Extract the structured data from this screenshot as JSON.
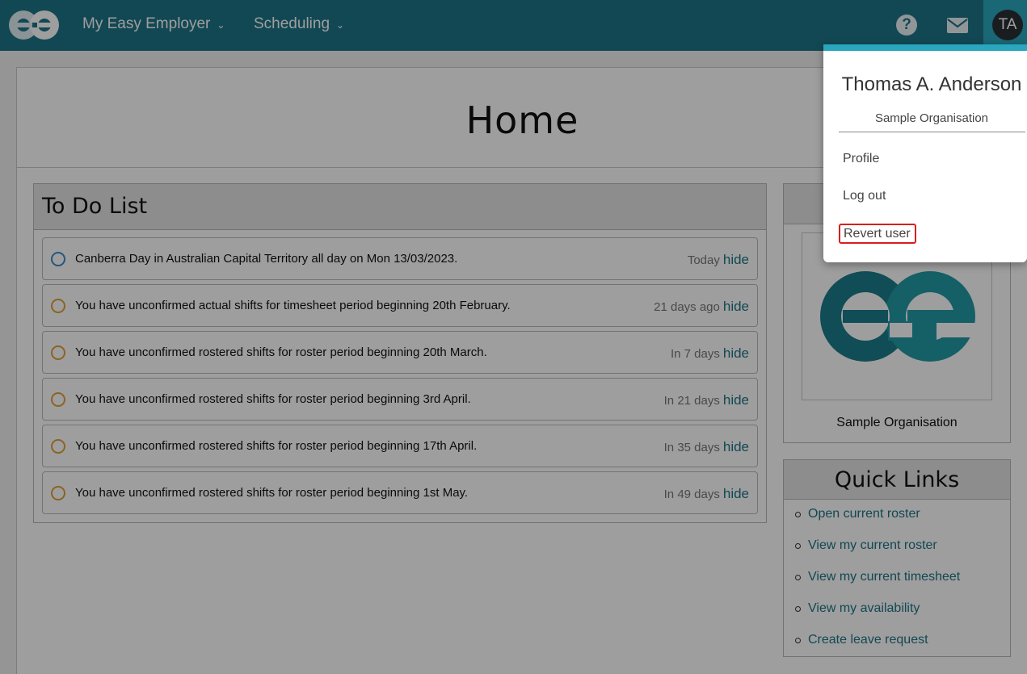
{
  "nav": {
    "menu1": "My Easy Employer",
    "menu2": "Scheduling",
    "avatar_initials": "TA"
  },
  "page": {
    "title": "Home"
  },
  "todo": {
    "title": "To Do List",
    "items": [
      {
        "status": "info",
        "text": "Canberra Day in Australian Capital Territory all day on Mon 13/03/2023.",
        "when": "Today",
        "action": "hide"
      },
      {
        "status": "warning",
        "text": "You have unconfirmed actual shifts for timesheet period beginning 20th February.",
        "when": "21 days ago",
        "action": "hide"
      },
      {
        "status": "warning",
        "text": "You have unconfirmed rostered shifts for roster period beginning 20th March.",
        "when": "In 7 days",
        "action": "hide"
      },
      {
        "status": "warning",
        "text": "You have unconfirmed rostered shifts for roster period beginning 3rd April.",
        "when": "In 21 days",
        "action": "hide"
      },
      {
        "status": "warning",
        "text": "You have unconfirmed rostered shifts for roster period beginning 17th April.",
        "when": "In 35 days",
        "action": "hide"
      },
      {
        "status": "warning",
        "text": "You have unconfirmed rostered shifts for roster period beginning 1st May.",
        "when": "In 49 days",
        "action": "hide"
      }
    ]
  },
  "org_panel": {
    "name": "Sample Organisation"
  },
  "quick_links": {
    "title": "Quick Links",
    "links": [
      "Open current roster",
      "View my current roster",
      "View my current timesheet",
      "View my availability",
      "Create leave request"
    ]
  },
  "user_menu": {
    "name": "Thomas A. Anderson",
    "organisation": "Sample Organisation",
    "profile": "Profile",
    "logout": "Log out",
    "revert": "Revert user"
  },
  "colors": {
    "primary": "#1e7486",
    "accent": "#2aa6bf",
    "warning": "#e3a03a",
    "info": "#3a8ccd",
    "highlight": "#d81e1e"
  }
}
